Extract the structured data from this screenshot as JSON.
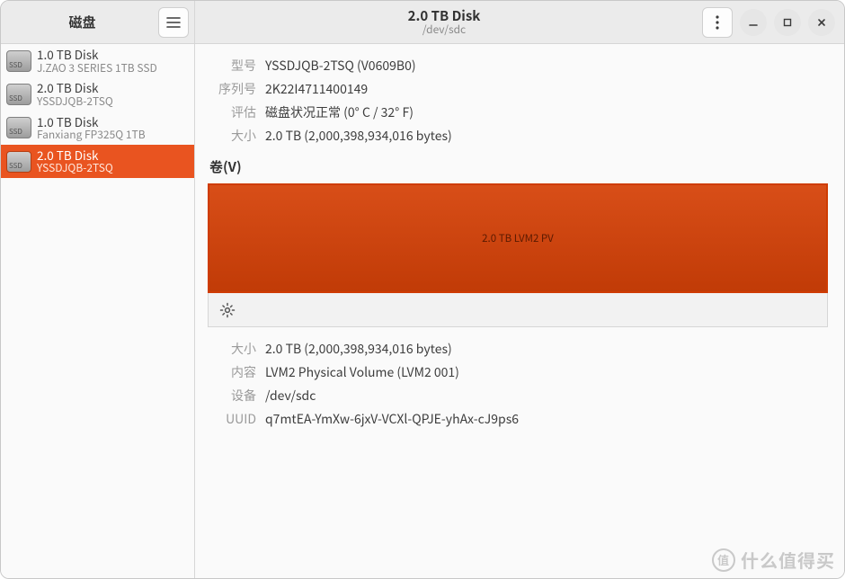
{
  "header": {
    "left_title": "磁盘",
    "center_title": "2.0 TB Disk",
    "center_sub": "/dev/sdc"
  },
  "sidebar": {
    "items": [
      {
        "title": "1.0 TB Disk",
        "sub": "J.ZAO 3 SERIES 1TB SSD",
        "selected": false
      },
      {
        "title": "2.0 TB Disk",
        "sub": "YSSDJQB-2TSQ",
        "selected": false
      },
      {
        "title": "1.0 TB Disk",
        "sub": "Fanxiang FP325Q 1TB",
        "selected": false
      },
      {
        "title": "2.0 TB Disk",
        "sub": "YSSDJQB-2TSQ",
        "selected": true
      }
    ]
  },
  "disk_info": {
    "model_label": "型号",
    "model_value": "YSSDJQB-2TSQ (V0609B0)",
    "serial_label": "序列号",
    "serial_value": "2K22I4711400149",
    "assess_label": "评估",
    "assess_value": "磁盘状况正常 (0° C / 32° F)",
    "size_label": "大小",
    "size_value": "2.0 TB (2,000,398,934,016 bytes)"
  },
  "volumes": {
    "section_title": "卷(V)",
    "partition_label": "2.0 TB LVM2 PV"
  },
  "volume_info": {
    "size_label": "大小",
    "size_value": "2.0 TB (2,000,398,934,016 bytes)",
    "content_label": "内容",
    "content_value": "LVM2 Physical Volume (LVM2 001)",
    "device_label": "设备",
    "device_value": "/dev/sdc",
    "uuid_label": "UUID",
    "uuid_value": "q7mtEA-YmXw-6jxV-VCXl-QPJE-yhAx-cJ9ps6"
  },
  "icons": {
    "ssd_badge": "SSD"
  },
  "watermark": {
    "badge": "值",
    "text": "什么值得买"
  }
}
